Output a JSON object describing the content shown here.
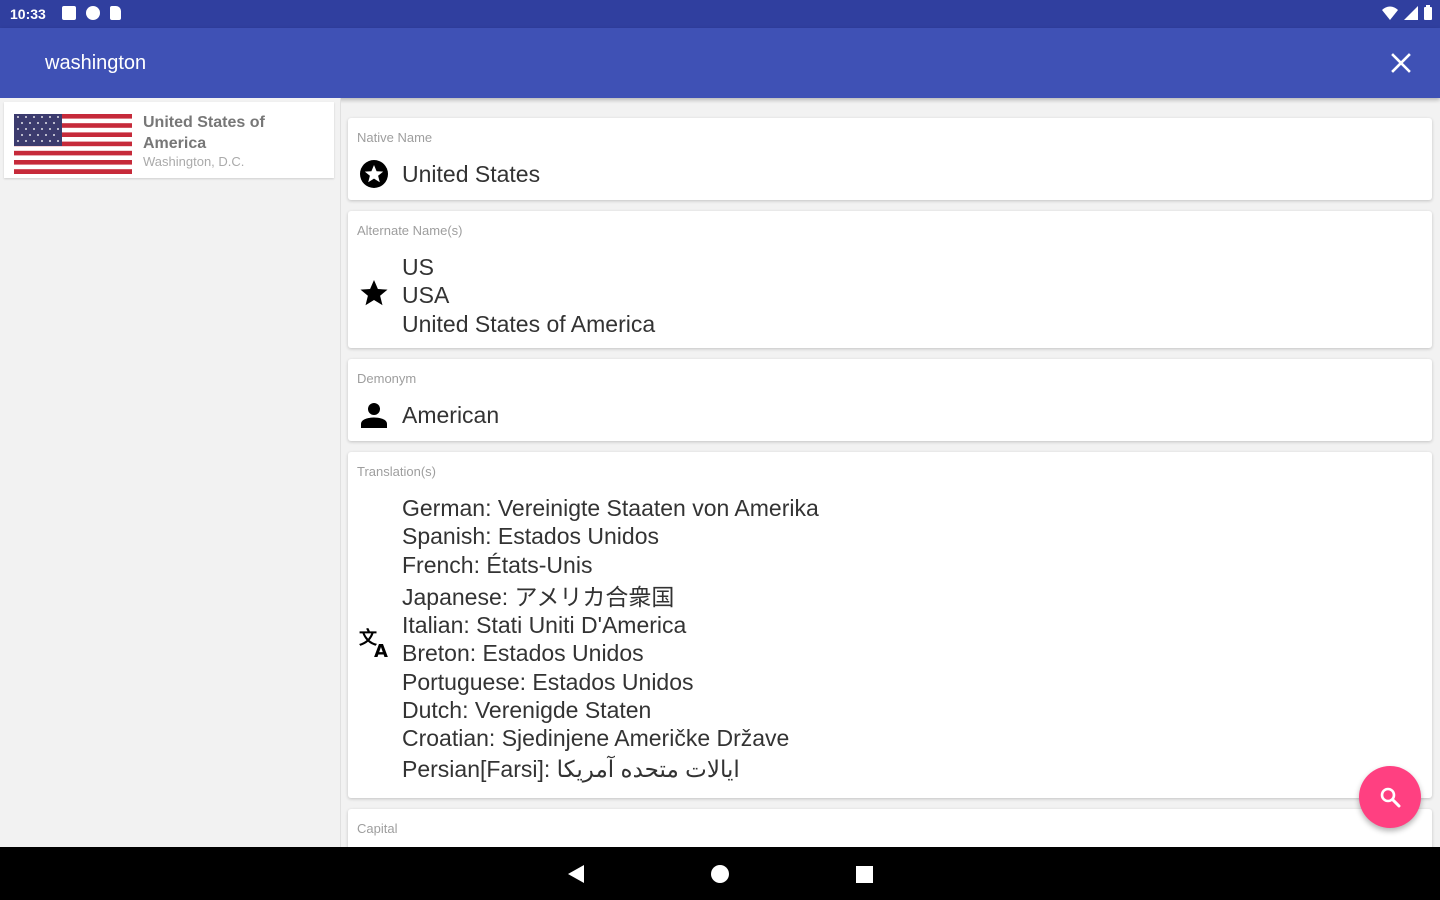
{
  "status_bar": {
    "time": "10:33"
  },
  "search": {
    "query": "washington"
  },
  "country_list": [
    {
      "name": "United States of America",
      "capital": "Washington, D.C."
    }
  ],
  "details": {
    "native_name": {
      "label": "Native Name",
      "value": "United States",
      "icon": "emblem-star-icon"
    },
    "alternate_names": {
      "label": "Alternate Name(s)",
      "values": [
        "US",
        "USA",
        "United States of America"
      ],
      "icon": "star-icon"
    },
    "demonym": {
      "label": "Demonym",
      "value": "American",
      "icon": "person-icon"
    },
    "translations": {
      "label": "Translation(s)",
      "icon": "translate-icon",
      "values": [
        "German: Vereinigte Staaten von Amerika",
        "Spanish: Estados Unidos",
        "French: États-Unis",
        "Japanese: アメリカ合衆国",
        "Italian: Stati Uniti D'America",
        "Breton: Estados Unidos",
        "Portuguese: Estados Unidos",
        "Dutch: Verenigde Staten",
        "Croatian: Sjedinjene Američke Države",
        "Persian[Farsi]: ایالات متحده آمریکا"
      ]
    },
    "capital": {
      "label": "Capital"
    }
  },
  "colors": {
    "primary": "#3f51b5",
    "primary_dark": "#303f9f",
    "accent": "#ff4081"
  },
  "icons": {
    "close": "close-icon",
    "fab": "search-icon",
    "nav_back": "back-triangle-icon",
    "nav_home": "home-circle-icon",
    "nav_recents": "recents-square-icon"
  }
}
